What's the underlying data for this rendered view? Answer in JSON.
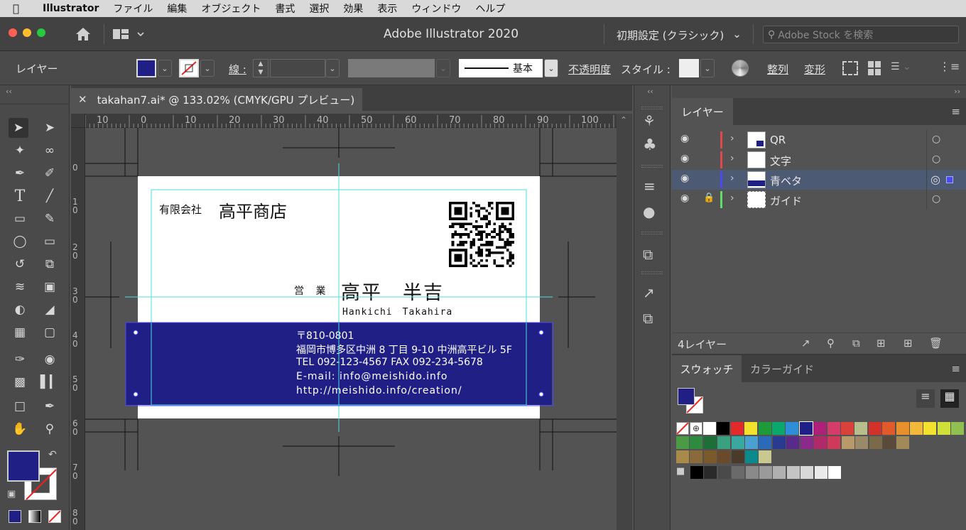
{
  "menubar": {
    "app": "Illustrator",
    "items": [
      "ファイル",
      "編集",
      "オブジェクト",
      "書式",
      "選択",
      "効果",
      "表示",
      "ウィンドウ",
      "ヘルプ"
    ]
  },
  "titlebar": {
    "title": "Adobe Illustrator 2020",
    "workspace": "初期設定 (クラシック)",
    "search_placeholder": "Adobe Stock を検索"
  },
  "controlbar": {
    "selection_label": "レイヤー",
    "stroke_label": "線 :",
    "brush_label": "基本",
    "opacity_label": "不透明度",
    "style_label": "スタイル :",
    "align_label": "整列",
    "transform_label": "変形",
    "fill_color": "#1f1f85"
  },
  "document": {
    "tab_title": "takahan7.ai* @ 133.02% (CMYK/GPU プレビュー)",
    "ruler_top": [
      "10",
      "0",
      "10",
      "20",
      "30",
      "40",
      "50",
      "60",
      "70",
      "80",
      "90",
      "100"
    ],
    "ruler_left": [
      "0",
      "1 0",
      "2 0",
      "3 0",
      "4 0",
      "5 0",
      "6 0",
      "7 0",
      "8 0"
    ]
  },
  "card": {
    "company_type": "有限会社",
    "company_name": "高平商店",
    "dept": "営 業",
    "person_name": "高平　半吉",
    "person_romaji": "Hankichi　Takahira",
    "postal": "〒810-0801",
    "address": "福岡市博多区中洲 8 丁目 9-10  中洲高平ビル 5F",
    "tel": "TEL 092-123-4567  FAX  092-234-5678",
    "email": "E-mail: info@meishido.info",
    "url": "http://meishido.info/creation/",
    "band_color": "#1f1f85"
  },
  "layers_panel": {
    "tab": "レイヤー",
    "layers": [
      {
        "name": "QR",
        "color": "#e0484e",
        "locked": false,
        "selected": false
      },
      {
        "name": "文字",
        "color": "#e0484e",
        "locked": false,
        "selected": false
      },
      {
        "name": "青ベタ",
        "color": "#4a4af0",
        "locked": false,
        "selected": true
      },
      {
        "name": "ガイド",
        "color": "#5fdc6a",
        "locked": true,
        "selected": false
      }
    ],
    "count_label": "4レイヤー"
  },
  "swatch_panel": {
    "tab_swatches": "スウォッチ",
    "tab_color_guide": "カラーガイド",
    "row1": [
      "#ffffff",
      "#000000",
      "#e22a2a",
      "#f2e22e",
      "#1e9a3a",
      "#0aa86c",
      "#2e8fd8",
      "#1f1f85",
      "#b0207a",
      "#d63c6a",
      "#d8423a",
      "#b8bd8c",
      "#d2322a",
      "#e05a2a",
      "#e8902c",
      "#f2b83a",
      "#f2e22e",
      "#cfe03a",
      "#90c050"
    ],
    "row2": [
      "#4c9a45",
      "#2e8a3e",
      "#1e6e38",
      "#3aa080",
      "#3aa8a0",
      "#4aa0d0",
      "#2a6ab8",
      "#2a3a90",
      "#5a2a8a",
      "#8a2a8a",
      "#b02a6a",
      "#d03a5a",
      "#b89a6a",
      "#9a8a6a",
      "#7a6a4a",
      "#5a4a3a",
      "#a08a5a"
    ],
    "row3": [
      "#a88a4a",
      "#8a6a3a",
      "#7a5a2a",
      "#6a4a2a",
      "#4a3a2a",
      "#0a8a8a",
      "#c8c890"
    ],
    "grays": [
      "#000000",
      "#2a2a2a",
      "#4a4a4a",
      "#6a6a6a",
      "#8a8a8a",
      "#9a9a9a",
      "#b0b0b0",
      "#c4c4c4",
      "#d8d8d8",
      "#eaeaea",
      "#ffffff"
    ]
  }
}
